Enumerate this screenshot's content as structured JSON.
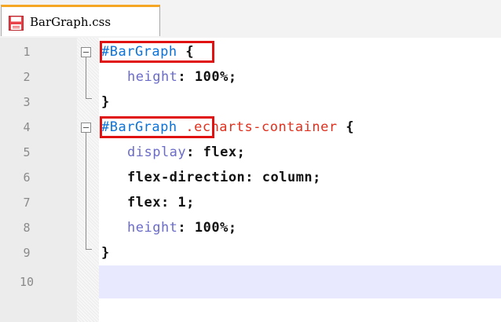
{
  "tab": {
    "filename": "BarGraph.css",
    "icon": "save-icon"
  },
  "editor": {
    "current_line": 10,
    "line_numbers": [
      "1",
      "2",
      "3",
      "4",
      "5",
      "6",
      "7",
      "8",
      "9",
      "10"
    ],
    "lines": {
      "l1": {
        "selector": "#BarGraph",
        "brace": " {"
      },
      "l2": {
        "property": "height",
        "colon": ": ",
        "value": "100%",
        "semi": ";"
      },
      "l3": {
        "brace": "}"
      },
      "l4": {
        "selector": "#BarGraph",
        "class": " .echarts-container",
        "brace": " {"
      },
      "l5": {
        "property": "display",
        "colon": ": ",
        "value": "flex",
        "semi": ";"
      },
      "l6": {
        "text": "flex-direction: column;"
      },
      "l7": {
        "text": "flex: 1;"
      },
      "l8": {
        "property": "height",
        "colon": ": ",
        "value": "100%",
        "semi": ";"
      },
      "l9": {
        "brace": "}"
      }
    }
  },
  "colors": {
    "selector": "#0d72d8",
    "property": "#6b6bc8",
    "class": "#e0301e",
    "highlight_box": "#e01212",
    "tab_accent": "#f5a623",
    "current_line": "#e8e8ff"
  }
}
